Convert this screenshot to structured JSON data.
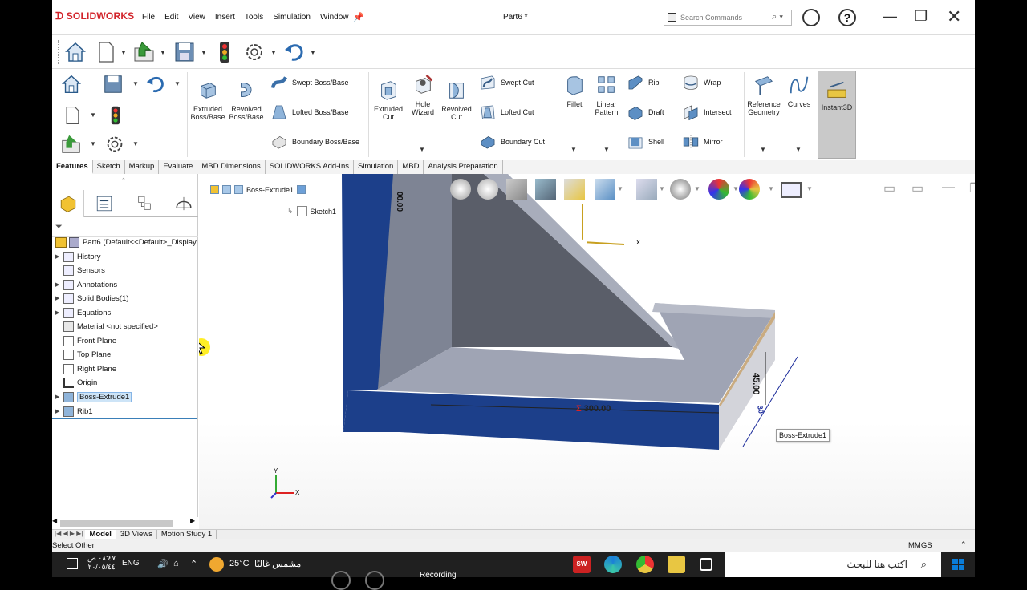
{
  "app": {
    "logo": "SOLIDWORKS",
    "menu": [
      "File",
      "Edit",
      "View",
      "Insert",
      "Tools",
      "Simulation",
      "Window"
    ],
    "document_title": "Part6 *",
    "search_placeholder": "Search Commands"
  },
  "ribbon": {
    "extruded_boss": "Extruded Boss/Base",
    "revolved_boss": "Revolved Boss/Base",
    "swept_boss": "Swept Boss/Base",
    "lofted_boss": "Lofted Boss/Base",
    "boundary_boss": "Boundary Boss/Base",
    "extruded_cut": "Extruded Cut",
    "hole_wizard": "Hole Wizard",
    "revolved_cut": "Revolved Cut",
    "swept_cut": "Swept Cut",
    "lofted_cut": "Lofted Cut",
    "boundary_cut": "Boundary Cut",
    "fillet": "Fillet",
    "linear_pattern": "Linear Pattern",
    "rib": "Rib",
    "draft": "Draft",
    "shell": "Shell",
    "wrap": "Wrap",
    "intersect": "Intersect",
    "mirror": "Mirror",
    "reference_geometry": "Reference Geometry",
    "curves": "Curves",
    "instant3d": "Instant3D"
  },
  "tabs": [
    "Features",
    "Sketch",
    "Markup",
    "Evaluate",
    "MBD Dimensions",
    "SOLIDWORKS Add-Ins",
    "Simulation",
    "MBD",
    "Analysis Preparation"
  ],
  "tree": {
    "root": "Part6  (Default<<Default>_Display",
    "items": [
      {
        "label": "History",
        "expandable": true
      },
      {
        "label": "Sensors",
        "expandable": false
      },
      {
        "label": "Annotations",
        "expandable": true
      },
      {
        "label": "Solid Bodies(1)",
        "expandable": true
      },
      {
        "label": "Equations",
        "expandable": true
      },
      {
        "label": "Material <not specified>",
        "expandable": false
      },
      {
        "label": "Front Plane",
        "expandable": false
      },
      {
        "label": "Top Plane",
        "expandable": false
      },
      {
        "label": "Right Plane",
        "expandable": false
      },
      {
        "label": "Origin",
        "expandable": false
      },
      {
        "label": "Boss-Extrude1",
        "expandable": true,
        "selected": true
      },
      {
        "label": "Rib1",
        "expandable": true
      }
    ]
  },
  "viewport": {
    "breadcrumb_feature": "Boss-Extrude1",
    "breadcrumb_sketch": "Sketch1",
    "dimension_length": "300.00",
    "dimension_height": "45.00",
    "dimension_top": "00.00",
    "dimension_width_fragment": "30",
    "axis_x": "x",
    "tooltip": "Boss-Extrude1",
    "triad_x": "X",
    "triad_y": "Y"
  },
  "bottom_tabs": [
    "Model",
    "3D Views",
    "Motion Study 1"
  ],
  "status": {
    "left": "Select Other",
    "units": "MMGS"
  },
  "taskbar": {
    "time": "٠٨:٤٧ ص",
    "date": "٢٠/٠٥/٤٤",
    "language": "ENG",
    "temperature": "25°C",
    "weather": "مشمس غالبًا",
    "recording": "Recording",
    "search_placeholder": "اكتب هنا للبحث"
  },
  "colors": {
    "brand_red": "#d2232a",
    "selection_blue": "#cde4f7",
    "model_face": "#1c3f8a",
    "model_top": "#9fa4b4"
  }
}
